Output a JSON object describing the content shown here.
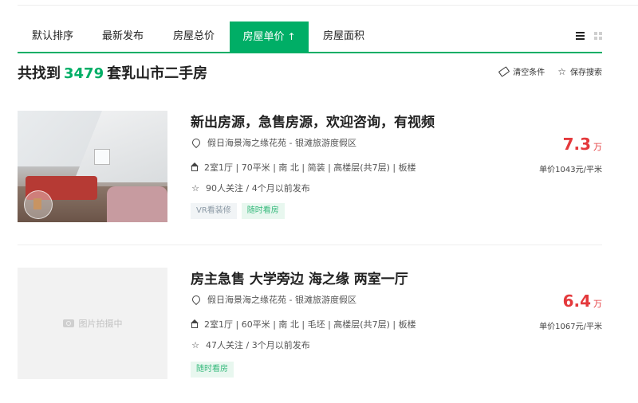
{
  "tabs": [
    {
      "label": "默认排序",
      "active": false
    },
    {
      "label": "最新发布",
      "active": false
    },
    {
      "label": "房屋总价",
      "active": false
    },
    {
      "label": "房屋单价",
      "active": true,
      "arrow": "↑"
    },
    {
      "label": "房屋面积",
      "active": false
    }
  ],
  "header": {
    "prefix": "共找到",
    "count": "3479",
    "suffix": "套乳山市二手房",
    "clear_label": "清空条件",
    "save_label": "保存搜索"
  },
  "listings": [
    {
      "title": "新出房源，急售房源，欢迎咨询，有视频",
      "location": "假日海景海之缘花苑 - 银滩旅游度假区",
      "details": "2室1厅 | 70平米 | 南 北 | 简装 | 高楼层(共7层) | 板楼",
      "follow": "90人关注 / 4个月以前发布",
      "tags": [
        "VR看装修",
        "随时看房"
      ],
      "price": "7.3",
      "price_unit": "万",
      "unit_price": "单价1043元/平米",
      "image": "photo"
    },
    {
      "title": "房主急售 大学旁边 海之缘 两室一厅",
      "location": "假日海景海之缘花苑 - 银滩旅游度假区",
      "details": "2室1厅 | 60平米 | 南 北 | 毛坯 | 高楼层(共7层) | 板楼",
      "follow": "47人关注 / 3个月以前发布",
      "tags": [
        "随时看房"
      ],
      "price": "6.4",
      "price_unit": "万",
      "unit_price": "单价1067元/平米",
      "image": "placeholder",
      "placeholder_text": "图片拍摄中"
    }
  ],
  "icons": {
    "location": "map-pin-icon",
    "layout": "house-icon",
    "follow": "star-icon",
    "clear": "eraser-icon",
    "save": "star-icon"
  },
  "colors": {
    "accent": "#00ae66",
    "price": "#e4393c"
  }
}
